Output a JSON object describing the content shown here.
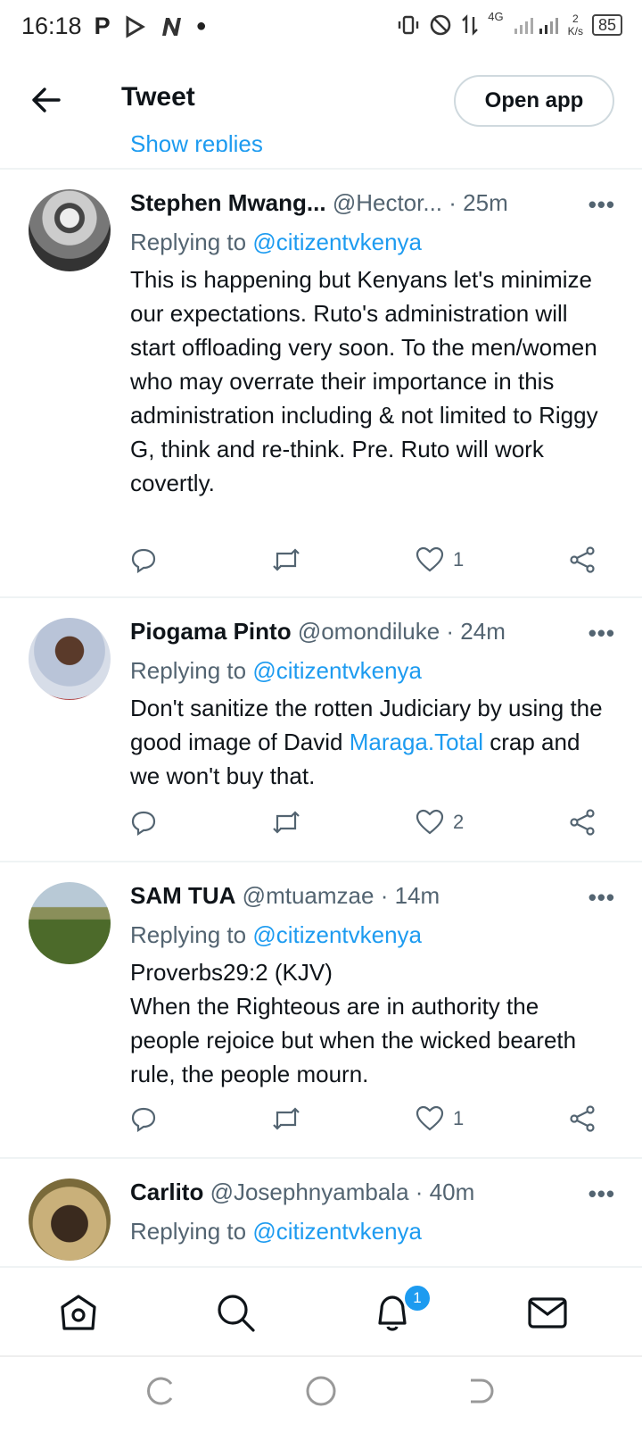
{
  "status": {
    "time": "16:18",
    "network": "4G",
    "speed_value": "2",
    "speed_unit": "K/s",
    "battery": "85"
  },
  "header": {
    "title": "Tweet",
    "open_app_label": "Open app"
  },
  "show_replies": "Show replies",
  "tweets": [
    {
      "name": "Stephen Mwang...",
      "handle": "@Hector...",
      "time": "· 25m",
      "replying_prefix": "Replying to ",
      "replying_to": "@citizentvkenya",
      "text": "This is happening but Kenyans let's minimize our expectations. Ruto's administration will start offloading very soon. To the men/women who may overrate their importance in this administration including & not limited to Riggy G, think and re-think. Pre. Ruto will work covertly.",
      "likes": "1"
    },
    {
      "name": "Piogama Pinto",
      "handle": "@omondiluke",
      "time": "· 24m",
      "replying_prefix": "Replying to ",
      "replying_to": "@citizentvkenya",
      "text_before": "Don't sanitize the rotten Judiciary by using the good image of David ",
      "text_link": "Maraga.Total",
      "text_after": " crap and we won't buy that.",
      "likes": "2"
    },
    {
      "name": "SAM TUA",
      "handle": "@mtuamzae",
      "time": "· 14m",
      "replying_prefix": "Replying to ",
      "replying_to": "@citizentvkenya",
      "text_line1": "Proverbs29:2 (KJV)",
      "text": "When the Righteous are in authority the people rejoice but when the wicked beareth rule, the people mourn.",
      "likes": "1"
    },
    {
      "name": "Carlito",
      "handle": "@Josephnyambala",
      "time": "· 40m",
      "replying_prefix": "Replying to ",
      "replying_to": "@citizentvkenya"
    }
  ],
  "more_label": "•••",
  "notifications_badge": "1",
  "colors": {
    "accent": "#1d9bf0",
    "secondary_text": "#536471",
    "divider": "#eff3f4"
  }
}
